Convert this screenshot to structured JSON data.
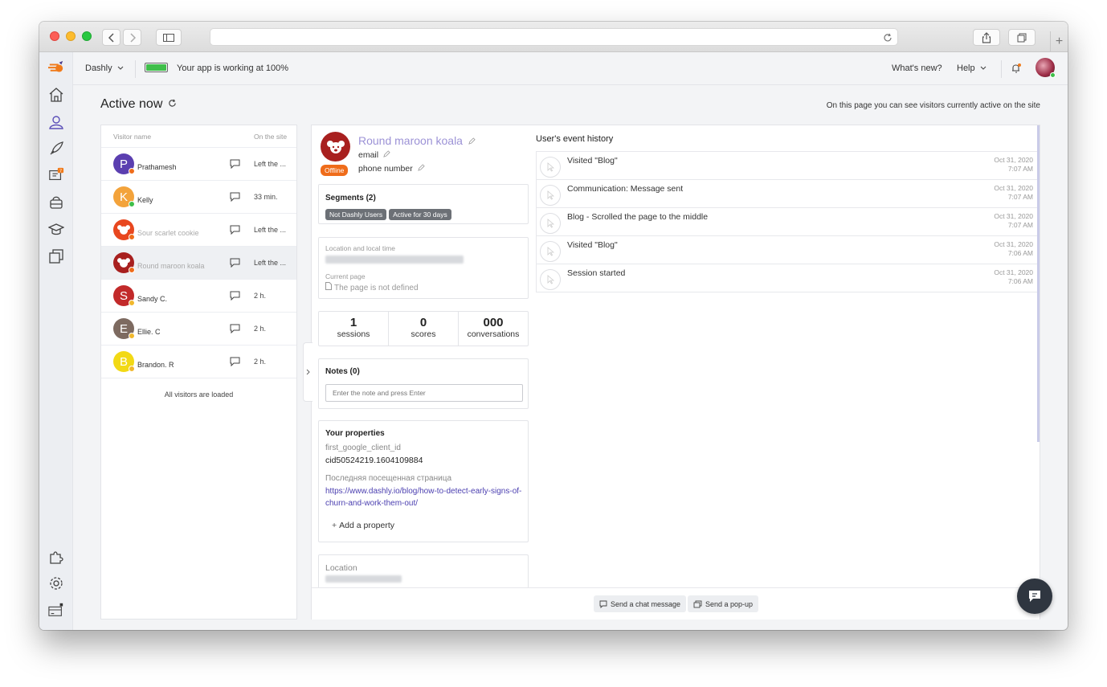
{
  "browser": {
    "url": ""
  },
  "topbar": {
    "workspace": "Dashly",
    "status_text": "Your app is working at 100%",
    "whats_new": "What's new?",
    "help": "Help"
  },
  "page": {
    "title": "Active now",
    "hint": "On this page you can see visitors currently active on the site"
  },
  "visitors": {
    "col_name": "Visitor name",
    "col_site": "On the site",
    "rows": [
      {
        "initial": "P",
        "name": "Prathamesh",
        "site": "Left the ...",
        "avatar_color": "#5b3fb0",
        "status_color": "#ef6c1a",
        "muted": false
      },
      {
        "initial": "K",
        "name": "Kelly",
        "site": "33 min.",
        "avatar_color": "#f3a33b",
        "status_color": "#3fbf4a",
        "muted": false
      },
      {
        "initial": "",
        "name": "Sour scarlet cookie",
        "site": "Left the ...",
        "avatar_color": "#e8471f",
        "status_color": "#ef6c1a",
        "muted": true
      },
      {
        "initial": "",
        "name": "Round maroon koala",
        "site": "Left the ...",
        "avatar_color": "#a8201f",
        "status_color": "#ef6c1a",
        "muted": true
      },
      {
        "initial": "S",
        "name": "Sandy C.",
        "site": "2 h.",
        "avatar_color": "#c22a2a",
        "status_color": "#f1b82d",
        "muted": false
      },
      {
        "initial": "E",
        "name": "Ellie. C",
        "site": "2 h.",
        "avatar_color": "#7d6a60",
        "status_color": "#f1b82d",
        "muted": false
      },
      {
        "initial": "B",
        "name": "Brandon. R",
        "site": "2 h.",
        "avatar_color": "#f2d915",
        "status_color": "#f1b82d",
        "muted": false
      }
    ],
    "footer": "All visitors are loaded"
  },
  "profile": {
    "name": "Round maroon koala",
    "email": "email",
    "phone": "phone number",
    "status": "Offline",
    "segments_title": "Segments (2)",
    "segments": [
      "Not Dashly Users",
      "Active for 30 days"
    ],
    "location_label": "Location and local time",
    "current_page_label": "Current page",
    "current_page_value": "The page is not defined",
    "stats": [
      {
        "value": "1",
        "label": "sessions"
      },
      {
        "value": "0",
        "label": "scores"
      },
      {
        "value": "000",
        "label": "conversations"
      }
    ],
    "notes_title": "Notes (0)",
    "notes_placeholder": "Enter the note and press Enter",
    "properties_title": "Your properties",
    "prop1_key": "first_google_client_id",
    "prop1_value": "cid50524219.1604109884",
    "prop2_key": "Последняя посещенная страница",
    "prop2_value": "https://www.dashly.io/blog/how-to-detect-early-signs-of-churn-and-work-them-out/",
    "add_property": "Add a property",
    "location_title": "Location"
  },
  "history": {
    "title": "User's event history",
    "events": [
      {
        "title": "Visited \"Blog\"",
        "date": "Oct 31, 2020",
        "time": "7:07 AM"
      },
      {
        "title": "Communication: Message sent",
        "date": "Oct 31, 2020",
        "time": "7:07 AM"
      },
      {
        "title": "Blog - Scrolled the page to the middle",
        "date": "Oct 31, 2020",
        "time": "7:07 AM"
      },
      {
        "title": "Visited \"Blog\"",
        "date": "Oct 31, 2020",
        "time": "7:06 AM"
      },
      {
        "title": "Session started",
        "date": "Oct 31, 2020",
        "time": "7:06 AM"
      }
    ]
  },
  "actions": {
    "send_chat": "Send a chat message",
    "send_popup": "Send a pop-up"
  },
  "colors": {
    "accent": "#7e6bd4",
    "offline": "#ef6c1a",
    "battery": "#3fbf4a",
    "link": "#4b3fb0"
  }
}
